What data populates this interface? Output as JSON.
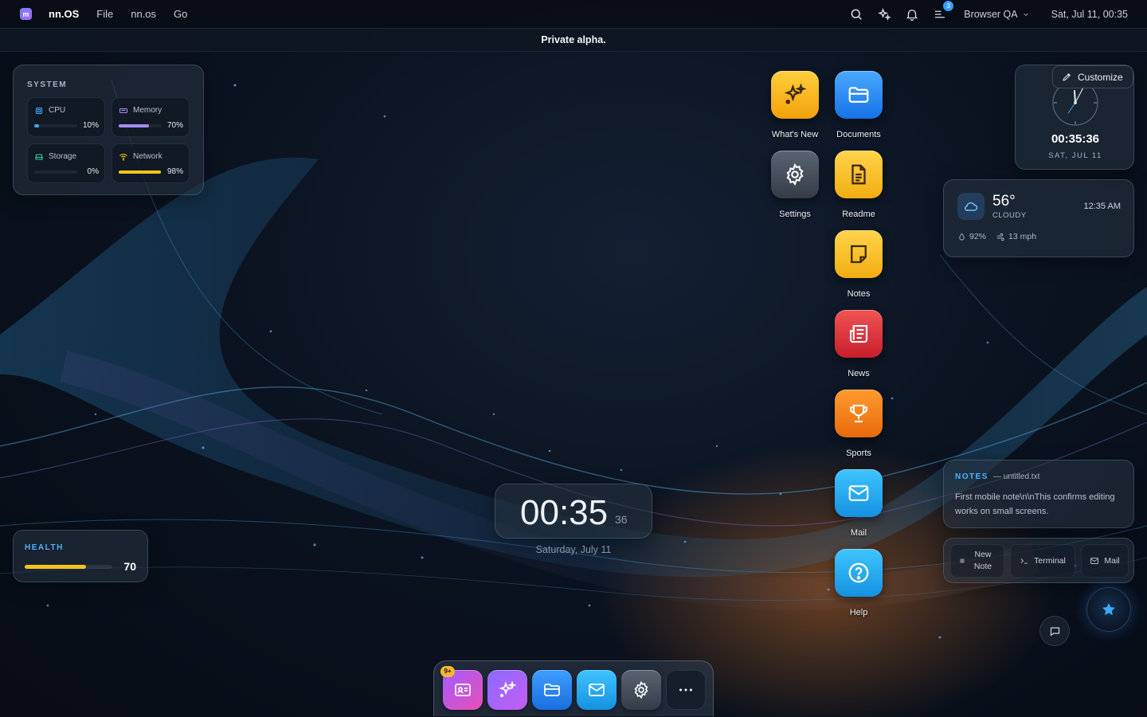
{
  "menubar": {
    "brand": "nn.OS",
    "menus": [
      "File",
      "nn.os",
      "Go"
    ],
    "notifications_badge": "3",
    "user": "Browser QA",
    "datetime": "Sat, Jul 11, 00:35"
  },
  "banner": {
    "text": "Private alpha."
  },
  "system": {
    "title": "SYSTEM",
    "stats": [
      {
        "label": "CPU",
        "value": "10%",
        "level": 0.1,
        "color": "#3fa9ff"
      },
      {
        "label": "Memory",
        "value": "70%",
        "level": 0.7,
        "color": "#a78bfa"
      },
      {
        "label": "Storage",
        "value": "0%",
        "level": 0.0,
        "color": "#34d399"
      },
      {
        "label": "Network",
        "value": "98%",
        "level": 0.98,
        "color": "#f5c518"
      }
    ]
  },
  "health": {
    "title": "HEALTH",
    "value": "70",
    "level": 0.7
  },
  "desktop_icons": [
    {
      "label": "What's New",
      "icon": "sparkle-icon"
    },
    {
      "label": "Documents",
      "icon": "folder-icon"
    },
    {
      "label": "Settings",
      "icon": "gear-icon"
    },
    {
      "label": "Readme",
      "icon": "document-icon"
    },
    {
      "label": "Notes",
      "icon": "note-icon"
    },
    {
      "label": "News",
      "icon": "newspaper-icon"
    },
    {
      "label": "Sports",
      "icon": "trophy-icon"
    },
    {
      "label": "Mail",
      "icon": "mail-icon"
    },
    {
      "label": "Help",
      "icon": "help-icon"
    }
  ],
  "center_clock": {
    "time": "00:35",
    "seconds": "36",
    "date": "Saturday, July 11"
  },
  "clock_widget": {
    "time": "00:35:36",
    "date": "SAT, JUL 11"
  },
  "customize": {
    "label": "Customize"
  },
  "weather": {
    "temp": "56°",
    "condition": "CLOUDY",
    "time": "12:35 AM",
    "humidity": "92%",
    "wind": "13 mph"
  },
  "notes": {
    "title": "NOTES",
    "file": "— untitled.txt",
    "body": "First mobile note\\n\\nThis confirms editing works on small screens."
  },
  "quick_actions": {
    "new_note": "New Note",
    "terminal": "Terminal",
    "mail": "Mail"
  },
  "dock": {
    "badge": "9+",
    "apps": [
      "contacts-app",
      "whats-new-app",
      "files-app",
      "mail-app",
      "settings-app",
      "more-app"
    ]
  },
  "colors": {
    "accent": "#3a9bff",
    "yellow": "#f5c518",
    "purple": "#a78bfa"
  }
}
